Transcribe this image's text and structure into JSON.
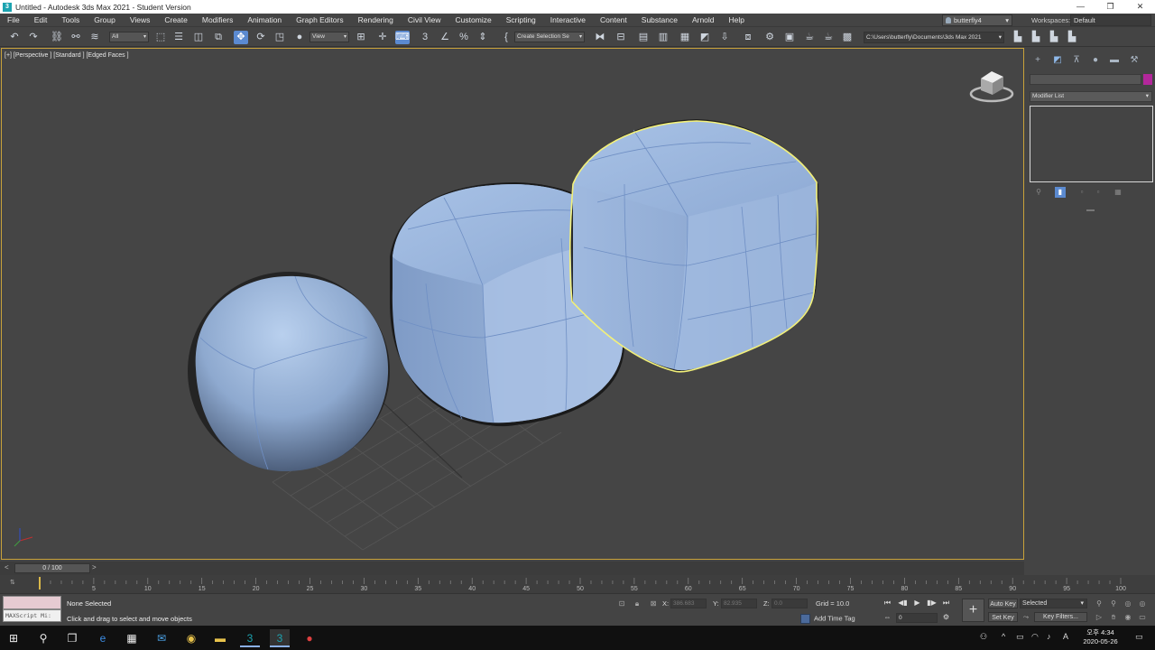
{
  "window": {
    "title": "Untitled - Autodesk 3ds Max 2021 - Student Version",
    "controls": [
      "—",
      "❐",
      "✕"
    ]
  },
  "menu": {
    "items": [
      "File",
      "Edit",
      "Tools",
      "Group",
      "Views",
      "Create",
      "Modifiers",
      "Animation",
      "Graph Editors",
      "Rendering",
      "Civil View",
      "Customize",
      "Scripting",
      "Interactive",
      "Content",
      "Substance",
      "Arnold",
      "Help"
    ],
    "user": "butterfly4",
    "workspaces_label": "Workspaces:",
    "workspace_value": "Default"
  },
  "toolbar": {
    "selection_filter": "All",
    "reference_coord": "View",
    "named_selection": "Create Selection Se",
    "project_path": "C:\\Users\\butterfly\\Documents\\3ds Max 2021"
  },
  "viewport": {
    "label": "[+] [Perspective ] [Standard ] [Edged Faces ]",
    "selection_color": "#f2f07a",
    "object_color": "#9db7dc"
  },
  "command_panel": {
    "modifier_list": "Modifier List",
    "object_color": "#b3279b"
  },
  "timeline": {
    "frame_display": "0 / 100",
    "ticks": [
      "5",
      "10",
      "15",
      "20",
      "25",
      "30",
      "35",
      "40",
      "45",
      "50",
      "55",
      "60",
      "65",
      "70",
      "75",
      "80",
      "85",
      "90",
      "95",
      "100"
    ]
  },
  "status": {
    "maxscript": "MAXScript Mi:",
    "selection": "None Selected",
    "prompt": "Click and drag to select and move objects",
    "x_label": "X:",
    "x_value": "386.683",
    "y_label": "Y:",
    "y_value": "82.935",
    "z_label": "Z:",
    "z_value": "0.0",
    "grid": "Grid = 10.0",
    "add_time_tag": "Add Time Tag",
    "frame": "0",
    "auto_key": "Auto Key",
    "set_key": "Set Key",
    "selected_drop": "Selected",
    "key_filters": "Key Filters..."
  },
  "taskbar": {
    "time": "오후 4:34",
    "date": "2020-05-26",
    "ime": "A"
  }
}
